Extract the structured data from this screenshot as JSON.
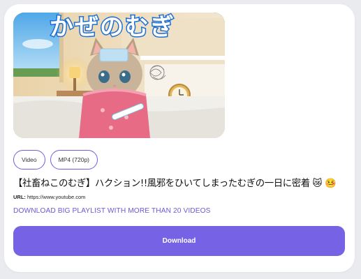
{
  "video": {
    "thumbnail_caption": "かぜのむぎ",
    "title": "【社畜ねこのむぎ】ハクション!!風邪をひいてしまったむぎの一日に密着 😿 🤒",
    "url_label": "URL:",
    "url": "https://www.youtube.com"
  },
  "chips": [
    {
      "label": "Video"
    },
    {
      "label": "MP4 (720p)"
    }
  ],
  "playlist_link": "DOWNLOAD BIG PLAYLIST WITH MORE THAN 20 VIDEOS",
  "download_button": "Download",
  "colors": {
    "accent": "#7562e4",
    "link": "#6a5ad8",
    "background": "#e9ebef",
    "card": "#ffffff"
  }
}
